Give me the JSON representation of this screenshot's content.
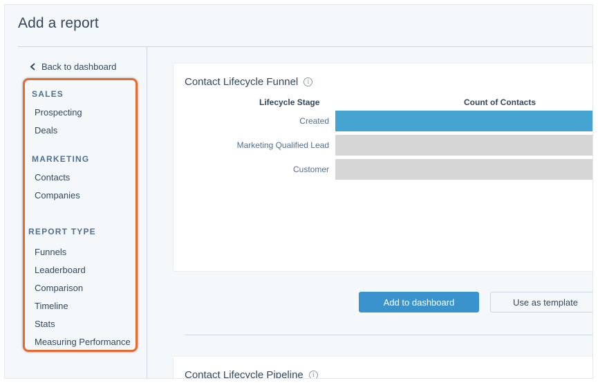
{
  "page": {
    "title": "Add a report"
  },
  "sidebar": {
    "back_label": "Back to dashboard",
    "sections": [
      {
        "heading": "SALES",
        "items": [
          "Prospecting",
          "Deals"
        ]
      },
      {
        "heading": "MARKETING",
        "items": [
          "Contacts",
          "Companies"
        ]
      },
      {
        "heading": "REPORT TYPE",
        "items": [
          "Funnels",
          "Leaderboard",
          "Comparison",
          "Timeline",
          "Stats",
          "Measuring Performance"
        ]
      }
    ],
    "highlight_color": "#e8692e"
  },
  "report_card": {
    "title": "Contact Lifecycle Funnel",
    "info_icon": "info-icon",
    "col_stage": "Lifecycle Stage",
    "col_count": "Count of Contacts",
    "rows": [
      {
        "stage": "Created",
        "color": "#45a4cf"
      },
      {
        "stage": "Marketing Qualified Lead",
        "color": "#d6d6d6"
      },
      {
        "stage": "Customer",
        "color": "#d6d6d6"
      }
    ]
  },
  "actions": {
    "add_label": "Add to dashboard",
    "template_label": "Use as template",
    "primary_color": "#3a93cc"
  },
  "report_card_2": {
    "title": "Contact Lifecycle Pipeline"
  }
}
